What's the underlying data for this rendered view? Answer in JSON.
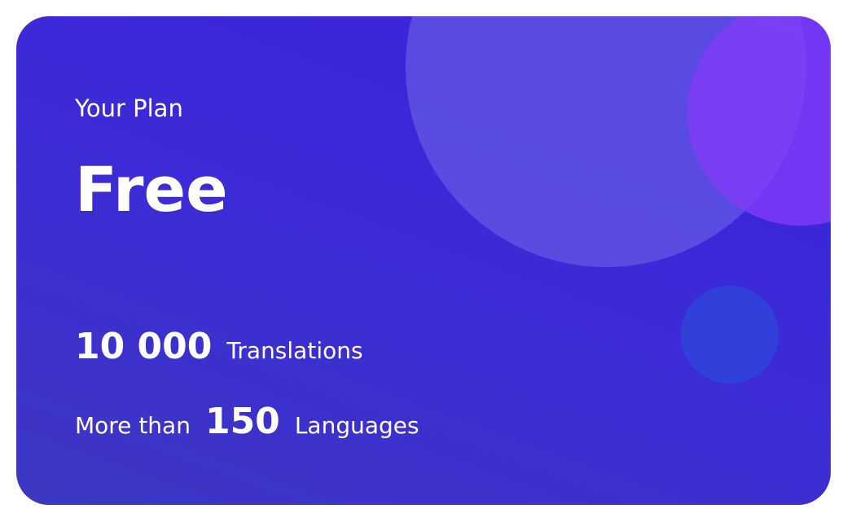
{
  "plan_card": {
    "label": "Your Plan",
    "plan_name": "Free",
    "translations": {
      "value": "10 000",
      "unit": "Translations"
    },
    "languages": {
      "prefix": "More than",
      "value": "150",
      "unit": "Languages"
    },
    "colors": {
      "background": "#3a25d8",
      "circle_large": "#5550dc",
      "circle_purple": "#7a3cf2",
      "circle_small": "#3240da"
    }
  }
}
